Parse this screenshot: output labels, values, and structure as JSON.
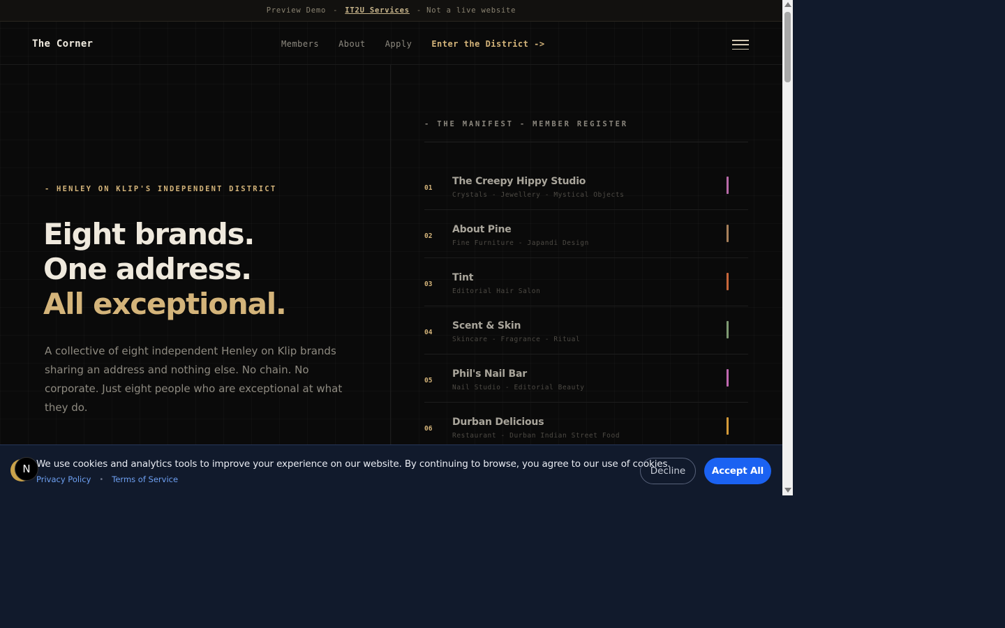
{
  "banner": {
    "prefix": "Preview Demo",
    "sep1": "-",
    "link": "IT2U Services",
    "suffix": "- Not a live website"
  },
  "nav": {
    "logo": "The Corner",
    "links": [
      "Members",
      "About",
      "Apply"
    ],
    "cta": "Enter the District ->"
  },
  "hero": {
    "eyebrow": "- HENLEY ON KLIP'S INDEPENDENT DISTRICT",
    "line1": "Eight brands.",
    "line2": "One address.",
    "line3": "All exceptional.",
    "description": "A collective of eight independent Henley on Klip brands sharing an address and nothing else. No chain. No corporate. Just eight people who are exceptional at what they do."
  },
  "manifest": {
    "heading": "- THE MANIFEST - MEMBER REGISTER",
    "members": [
      {
        "num": "01",
        "name": "The Creepy Hippy Studio",
        "tags": "Crystals - Jewellery - Mystical Objects",
        "color": "#b86aa8"
      },
      {
        "num": "02",
        "name": "About Pine",
        "tags": "Fine Furniture - Japandi Design",
        "color": "#a8805a"
      },
      {
        "num": "03",
        "name": "Tint",
        "tags": "Editorial Hair Salon",
        "color": "#c8663a"
      },
      {
        "num": "04",
        "name": "Scent & Skin",
        "tags": "Skincare - Fragrance - Ritual",
        "color": "#7e9a72"
      },
      {
        "num": "05",
        "name": "Phil's Nail Bar",
        "tags": "Nail Studio - Editorial Beauty",
        "color": "#c068b0"
      },
      {
        "num": "06",
        "name": "Durban Delicious",
        "tags": "Restaurant - Durban Indian Street Food",
        "color": "#d49a38"
      }
    ]
  },
  "cookie": {
    "message": "We use cookies and analytics tools to improve your experience on our website. By continuing to browse, you agree to our use of cookies.",
    "privacy": "Privacy Policy",
    "dot": "•",
    "terms": "Terms of Service",
    "decline": "Decline",
    "accept": "Accept All",
    "badge": "N"
  },
  "colors": {
    "accent_gold": "#d4b47a",
    "background": "#0a0a0a",
    "cookie_bg": "#111a2c",
    "accept_blue": "#1b62f2"
  }
}
